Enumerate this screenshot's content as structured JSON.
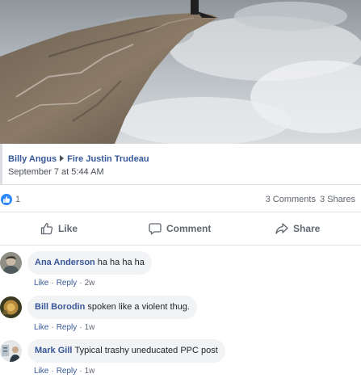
{
  "post": {
    "shared_from": {
      "author": "Billy Angus",
      "group": "Fire Justin Trudeau",
      "date": "September 7 at 5:44 AM"
    },
    "reactions_count": "1",
    "comments_count": "3 Comments",
    "shares_count": "3 Shares"
  },
  "actions": {
    "like": "Like",
    "comment": "Comment",
    "share": "Share"
  },
  "comments": [
    {
      "name": "Ana Anderson",
      "text": "ha ha ha ha",
      "like": "Like",
      "reply": "Reply",
      "time": "2w"
    },
    {
      "name": "Bill Borodin",
      "text": "spoken like a violent thug.",
      "like": "Like",
      "reply": "Reply",
      "time": "1w"
    },
    {
      "name": "Mark Gill",
      "text": "Typical trashy uneducated PPC post",
      "like": "Like",
      "reply": "Reply",
      "time": "1w"
    }
  ],
  "colors": {
    "link_blue": "#385898",
    "reaction_blue": "#2d88ff",
    "bubble_grey": "#f2f3f5",
    "divider": "#dddfe2"
  },
  "icons": {
    "like": "thumbs-up-icon",
    "comment": "speech-bubble-icon",
    "share": "share-arrow-icon"
  }
}
